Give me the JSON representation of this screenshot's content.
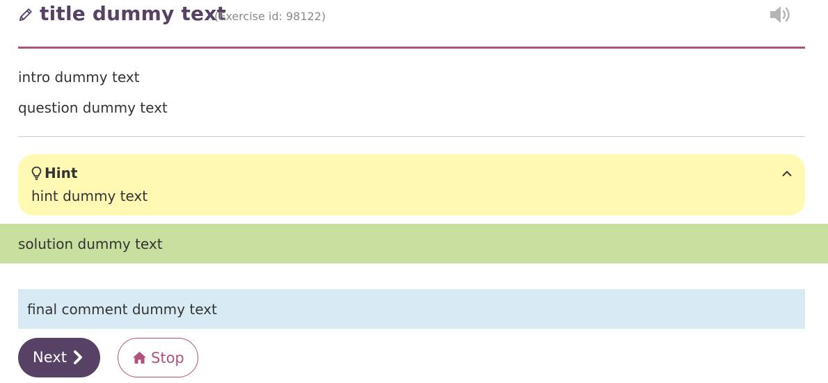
{
  "header": {
    "title": "title dummy text",
    "exercise_id": "(Exercise id: 98122)",
    "pencil_icon": "pencil-icon",
    "sound_icon": "volume-icon"
  },
  "content": {
    "intro": "intro dummy text",
    "question": "question dummy text"
  },
  "hint": {
    "title": "Hint",
    "text": "hint dummy text",
    "icon": "lightbulb-icon",
    "toggle_icon": "chevron-up-icon"
  },
  "solution": {
    "text": "solution dummy text"
  },
  "final_comment": {
    "text": "final comment dummy text"
  },
  "buttons": {
    "next_label": "Next",
    "next_icon": "chevron-right-icon",
    "stop_label": "Stop",
    "stop_icon": "home-icon"
  },
  "colors": {
    "accent": "#b1507f",
    "primary": "#574266",
    "hint_bg": "#fff9b4",
    "solution_bg": "#c8dfa0",
    "comment_bg": "#d8ebf5"
  }
}
